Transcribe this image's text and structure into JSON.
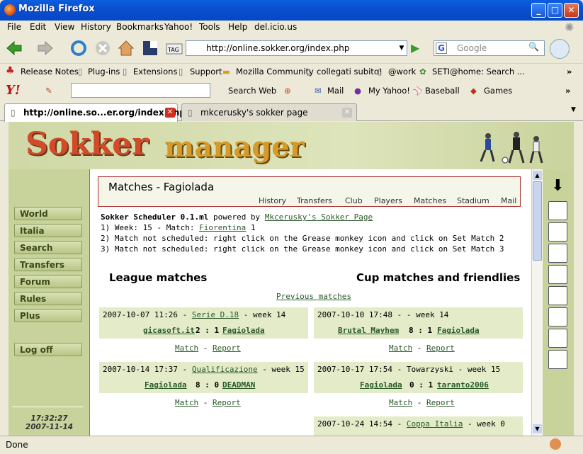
{
  "window": {
    "title": "Mozilla Firefox"
  },
  "menu": [
    "File",
    "Edit",
    "View",
    "History",
    "Bookmarks",
    "Yahoo!",
    "Tools",
    "Help",
    "del.icio.us"
  ],
  "nav": {
    "url": "http://online.sokker.org/index.php",
    "search_placeholder": "Google"
  },
  "bookmarks": [
    "Release Notes",
    "Plug-ins",
    "Extensions",
    "Support",
    "Mozilla Community",
    "collegati subito!",
    "@work",
    "SETI@home: Search ..."
  ],
  "yahoo": {
    "search_label": "Search Web",
    "mail": "Mail",
    "myyahoo": "My Yahoo!",
    "baseball": "Baseball",
    "games": "Games"
  },
  "tabs": [
    {
      "label": "http://online.so...er.org/index.php"
    },
    {
      "label": "mkcerusky's sokker page"
    }
  ],
  "site": {
    "logo_left": "Sokker",
    "logo_right": "manager",
    "left_menu": [
      "World",
      "Italia",
      "Search",
      "Transfers",
      "Forum",
      "Rules",
      "Plus"
    ],
    "logoff": "Log off",
    "time": "17:32:27",
    "date": "2007-11-14"
  },
  "main": {
    "title": "Matches - Fagiolada",
    "subnav": [
      "History",
      "Transfers",
      "Club",
      "Players",
      "Matches",
      "Stadium",
      "Mail"
    ],
    "scheduler_name": "Sokker Scheduler 0.1.ml",
    "powered_by": "powered by",
    "powered_link": "Mkcerusky's Sokker Page",
    "line1_prefix": "1) Week: 15 - Match:",
    "line1_team": "Fiorentina",
    "line1_suffix": "1",
    "line2": "2) Match not scheduled: right click on the Grease monkey icon and click on Set Match 2",
    "line3": "3) Match not scheduled: right click on the Grease monkey icon and click on Set Match 3",
    "league_header": "League matches",
    "cup_header": "Cup matches and friendlies",
    "previous": "Previous matches",
    "match_label": "Match",
    "report_label": "Report",
    "sep": "-",
    "league": [
      {
        "date": "2007-10-07 11:26 -",
        "comp": "Serie D.18",
        "week": "- week 14",
        "home": "gicasoft.it",
        "score": "2 : 1",
        "away": "Fagiolada"
      },
      {
        "date": "2007-10-14 17:37 -",
        "comp": "Qualificazione",
        "week": "- week 15",
        "home": "Fagiolada",
        "score": "8 : 0",
        "away": "DEADMAN"
      }
    ],
    "cup": [
      {
        "date": "2007-10-10 17:48 - - week 14",
        "comp": "",
        "week": "",
        "home": "Brutal Mayhem",
        "score": "8 : 1",
        "away": "Fagiolada"
      },
      {
        "date": "2007-10-17 17:54 - Towarzyski - week 15",
        "comp": "",
        "week": "",
        "home": "Fagiolada",
        "score": "0 : 1",
        "away": "taranto2006"
      },
      {
        "date": "2007-10-24 14:54 -",
        "comp": "Coppa Italia",
        "week": "- week 0",
        "home": "",
        "score": "",
        "away": ""
      }
    ]
  },
  "status": "Done"
}
